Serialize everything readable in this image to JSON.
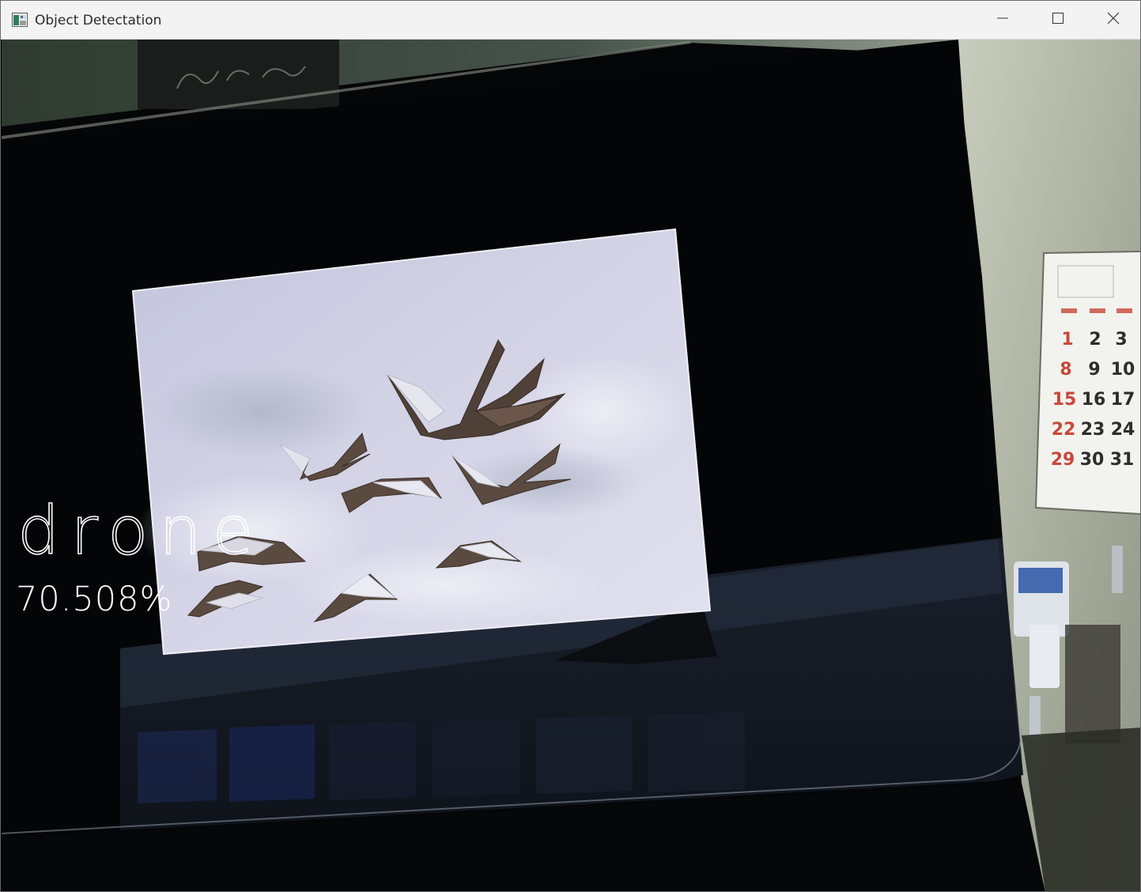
{
  "window": {
    "title": "Object Detectation",
    "icon": "app-window-icon",
    "controls": {
      "minimize_icon": "minimize-icon",
      "maximize_icon": "maximize-icon",
      "close_icon": "close-icon"
    }
  },
  "detection": {
    "label": "drone",
    "confidence": "70.508%"
  },
  "calendar": {
    "numbers": [
      "1",
      "2",
      "3",
      "8",
      "9",
      "10",
      "15",
      "16",
      "17",
      "22",
      "23",
      "24",
      "29",
      "30",
      "31"
    ]
  },
  "colors": {
    "titlebar_bg": "#f3f3f3",
    "overlay_text": "#ffffff",
    "calendar_red": "#c8483a"
  }
}
